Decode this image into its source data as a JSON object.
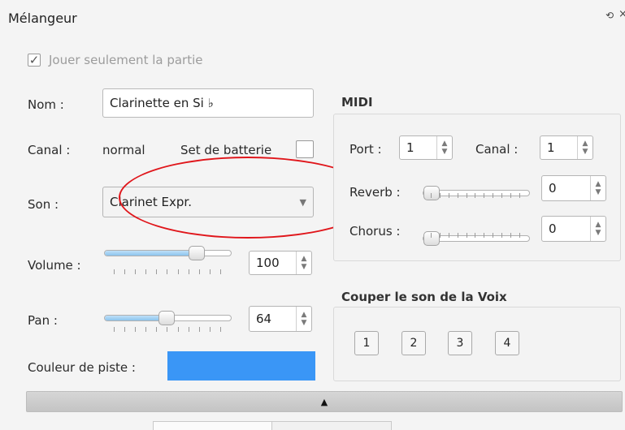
{
  "window": {
    "title": "Mélangeur"
  },
  "play_part_only": {
    "label": "Jouer seulement la partie",
    "checked": true
  },
  "name": {
    "label": "Nom :",
    "value": "Clarinette en Si ♭"
  },
  "channel": {
    "label": "Canal :",
    "value": "normal",
    "drumset_label": "Set de batterie",
    "drumset_checked": false
  },
  "sound": {
    "label": "Son :",
    "value": "Clarinet Expr."
  },
  "volume": {
    "label": "Volume :",
    "value": "100",
    "level_percent": 76
  },
  "pan": {
    "label": "Pan :",
    "value": "64",
    "level_percent": 50
  },
  "track_color": {
    "label": "Couleur de piste :",
    "color": "#3a96f6"
  },
  "midi": {
    "title": "MIDI",
    "port_label": "Port :",
    "port_value": "1",
    "channel_label": "Canal :",
    "channel_value": "1",
    "reverb_label": "Reverb :",
    "reverb_value": "0",
    "chorus_label": "Chorus :",
    "chorus_value": "0"
  },
  "mute_voice": {
    "title": "Couper le son de la Voix",
    "buttons": [
      "1",
      "2",
      "3",
      "4"
    ]
  },
  "icons": {
    "float": "float-icon",
    "close": "close-icon",
    "expand": "chevron-up-icon"
  },
  "annotation_color": "#e0161b"
}
